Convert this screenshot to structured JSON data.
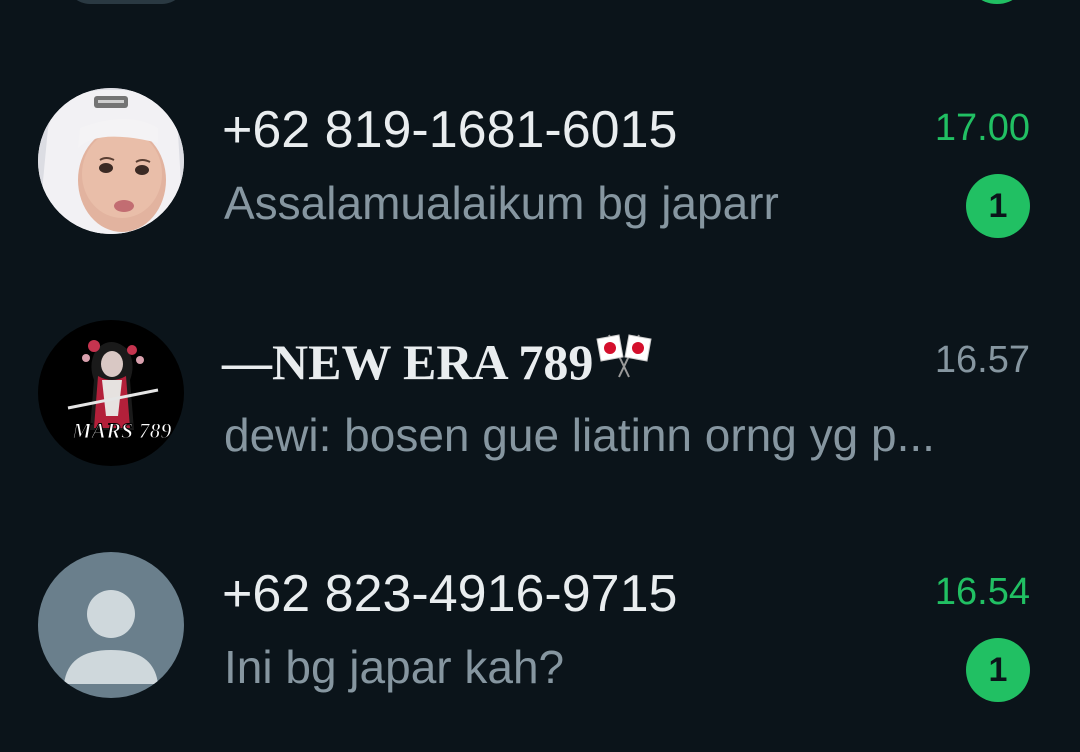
{
  "chats": [
    {
      "name": "+62 819-1681-6015",
      "time": "17.00",
      "preview": "Assalamualaikum bg japarr",
      "unread_count": "1",
      "unread": true,
      "avatar": "photo-avatar"
    },
    {
      "name": "—NEW ERA 789",
      "name_suffix_icon": "japan-crossed-flags-icon",
      "time": "16.57",
      "preview": "dewi: bosen gue liatinn orng yg p...",
      "unread": false,
      "avatar": "group-logo-avatar",
      "avatar_text": "MARS 789"
    },
    {
      "name": "+62 823-4916-9715",
      "time": "16.54",
      "preview": "Ini bg japar kah?",
      "unread_count": "1",
      "unread": true,
      "avatar": "default-person-avatar"
    }
  ],
  "colors": {
    "background": "#0b141a",
    "accent_green": "#21c063",
    "primary_text": "#e9edef",
    "secondary_text": "#8696a0",
    "default_avatar_bg": "#6a7f8c"
  }
}
